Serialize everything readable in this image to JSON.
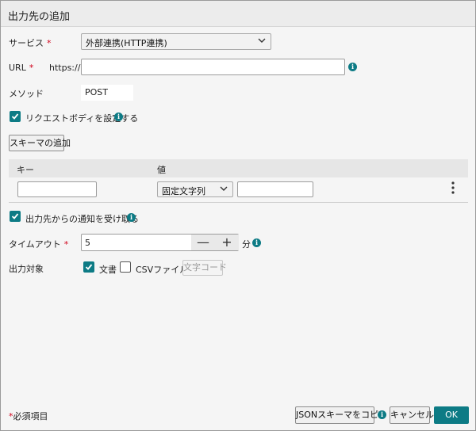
{
  "dialog": {
    "title": "出力先の追加"
  },
  "service": {
    "label": "サービス",
    "required_mark": "*",
    "selected": "外部連携(HTTP連携)"
  },
  "url": {
    "label": "URL",
    "required_mark": "*",
    "prefix": "https://",
    "value": ""
  },
  "method": {
    "label": "メソッド",
    "value": "POST"
  },
  "request_body": {
    "label": "リクエストボディを設定する",
    "checked": true
  },
  "add_schema_button": "スキーマの追加",
  "table": {
    "headers": {
      "key": "キー",
      "value": "値"
    },
    "rows": [
      {
        "key": "",
        "type": "固定文字列",
        "value": ""
      }
    ]
  },
  "notify": {
    "label": "出力先からの通知を受け取る",
    "checked": true
  },
  "timeout": {
    "label": "タイムアウト",
    "required_mark": "*",
    "value": "5",
    "minus": "—",
    "plus": "+",
    "unit": "分"
  },
  "output_target": {
    "label": "出力対象",
    "document": {
      "label": "文書",
      "checked": true
    },
    "csv": {
      "label": "CSVファイル",
      "checked": false
    },
    "charcode_button": "文字コード"
  },
  "footer": {
    "required_note": "*必須項目",
    "copy_json_button": "JSONスキーマをコピー",
    "cancel_button": "キャンセル",
    "ok_button": "OK"
  },
  "colors": {
    "accent": "#0d7b85",
    "required": "#d0021b"
  },
  "icons": [
    "info-icon",
    "chevron-down-icon",
    "check-icon",
    "kebab-menu-icon"
  ]
}
